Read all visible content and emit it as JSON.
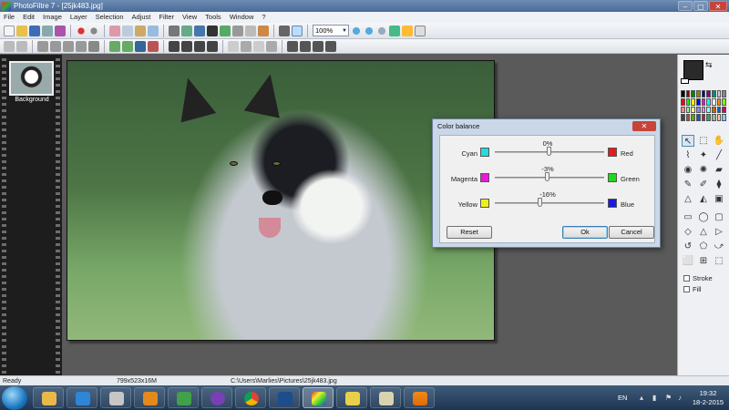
{
  "window": {
    "title": "PhotoFiltre 7 - [25jk483.jpg]",
    "buttons": {
      "minimize": "–",
      "maximize": "▢",
      "close": "✕"
    }
  },
  "menu": [
    "File",
    "Edit",
    "Image",
    "Layer",
    "Selection",
    "Adjust",
    "Filter",
    "View",
    "Tools",
    "Window",
    "?"
  ],
  "toolbar": {
    "zoom": "100%"
  },
  "layers": {
    "thumbnail_label": "Background"
  },
  "color_balance": {
    "title": "Color balance",
    "close": "✕",
    "rows": [
      {
        "left": "Cyan",
        "right": "Red",
        "value": "0%",
        "amount": 0,
        "left_color": "#22dde2",
        "right_color": "#e81a1a"
      },
      {
        "left": "Magenta",
        "right": "Green",
        "value": "-3%",
        "amount": -3,
        "left_color": "#e81ad8",
        "right_color": "#1ed81e"
      },
      {
        "left": "Yellow",
        "right": "Blue",
        "value": "-16%",
        "amount": -16,
        "left_color": "#eef01a",
        "right_color": "#1a1ae0"
      }
    ],
    "buttons": {
      "reset": "Reset",
      "ok": "Ok",
      "cancel": "Cancel"
    }
  },
  "tool_panel": {
    "stroke": "Stroke",
    "fill": "Fill"
  },
  "status": {
    "ready": "Ready",
    "dimensions": "799x523x16M",
    "path": "C:\\Users\\Marlies\\Pictures\\25jk483.jpg"
  },
  "taskbar": {
    "language": "EN",
    "time": "19:32",
    "date": "18-2-2015"
  }
}
